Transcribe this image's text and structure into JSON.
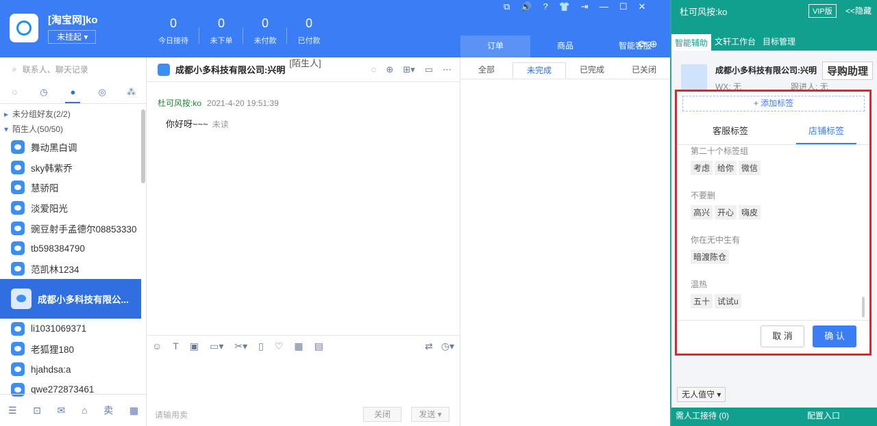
{
  "header": {
    "shop_name": "[淘宝网]ko",
    "status": "未挂起 ▾",
    "stats": [
      {
        "value": "0",
        "label": "今日接待"
      },
      {
        "value": "0",
        "label": "未下单"
      },
      {
        "value": "0",
        "label": "未付款"
      },
      {
        "value": "0",
        "label": "已付款"
      }
    ],
    "window_buttons": [
      "⧉",
      "🔊",
      "?",
      "👕",
      "⇥",
      "—",
      "☐",
      "✕"
    ],
    "order_tabs": [
      "订单",
      "商品",
      "智能客服"
    ]
  },
  "sidebar": {
    "search_placeholder": "联系人、聊天记录",
    "groups": [
      {
        "label": "未分组好友(2/2)"
      },
      {
        "label": "陌生人(50/50)"
      }
    ],
    "contacts": [
      "舞动黑白调",
      "sky韩紫乔",
      "慧骄阳",
      "淡爱阳光",
      "豌豆射手孟德尔08853330",
      "tb598384790",
      "范凯林1234",
      "成都小多科技有限公...",
      "li1031069371",
      "老狐狸180",
      "hjahdsa:a",
      "qwe272873461"
    ],
    "selected_index": 7,
    "bottom_icons": [
      "☰",
      "⊡",
      "✉",
      "⌂",
      "卖",
      "▦"
    ]
  },
  "chat": {
    "title": "成都小多科技有限公司:兴明",
    "tag": "[陌生人]",
    "message": {
      "sender": "杜可风按:ko",
      "time": "2021-4-20 19:51:39",
      "text": "你好呀~~~",
      "status": "未读"
    },
    "phrase": "请输用卖",
    "close": "关闭",
    "send": "发送 ▾"
  },
  "orders": {
    "status_tabs": [
      "全部",
      "未完成",
      "已完成",
      "已关闭"
    ],
    "active": "未完成"
  },
  "right_panel": {
    "user": "杜可风按:ko",
    "vip": "VIP版",
    "hide": "<<隐藏",
    "tabs": [
      "智能辅助",
      "文轩工作台",
      "目标管理"
    ],
    "customer": {
      "name": "成都小多科技有限公司:兴明",
      "shop_button": "导购助理",
      "wx_label": "WX:",
      "wx_value": "无",
      "follower_label": "跟进人:",
      "follower_value": "无"
    },
    "dialog": {
      "add_tag": "+ 添加标签",
      "tabs": [
        "客服标签",
        "店铺标签"
      ],
      "active_tab": "店铺标签",
      "groups": [
        {
          "name": "第二十个标签组",
          "tags": [
            "考虑",
            "给你",
            "微信"
          ]
        },
        {
          "name": "不要删",
          "tags": [
            "高兴",
            "开心",
            "嗨皮"
          ]
        },
        {
          "name": "你在无中生有",
          "tags": [
            "暗渡陈仓"
          ]
        },
        {
          "name": "温热",
          "tags": [
            "五十",
            "试试u"
          ]
        }
      ],
      "cancel": "取 消",
      "confirm": "确 认"
    },
    "unmanned": "无人值守 ▾",
    "bottom_left": "需人工接待 (0)",
    "bottom_right": "配置入口"
  }
}
